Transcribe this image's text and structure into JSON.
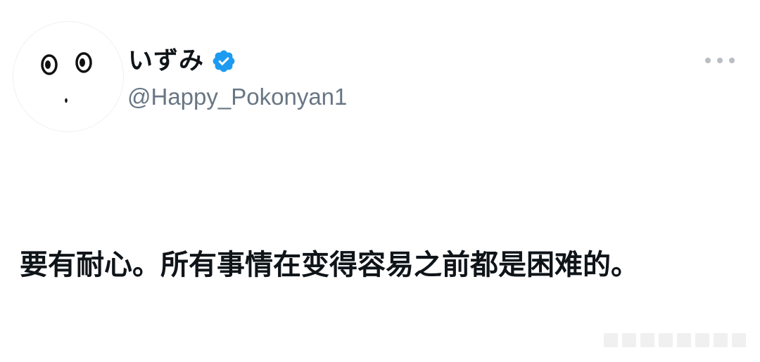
{
  "tweet": {
    "display_name": "いずみ",
    "handle": "@Happy_Pokonyan1",
    "text": "要有耐心。所有事情在变得容易之前都是困难的。",
    "verified": true
  },
  "icons": {
    "avatar": "face-doodle-avatar",
    "verified": "verified-badge-icon",
    "more": "more-horizontal-icon"
  },
  "colors": {
    "verified_blue": "#1d9bf0",
    "handle_gray": "#687684",
    "text_black": "#0f1419"
  }
}
